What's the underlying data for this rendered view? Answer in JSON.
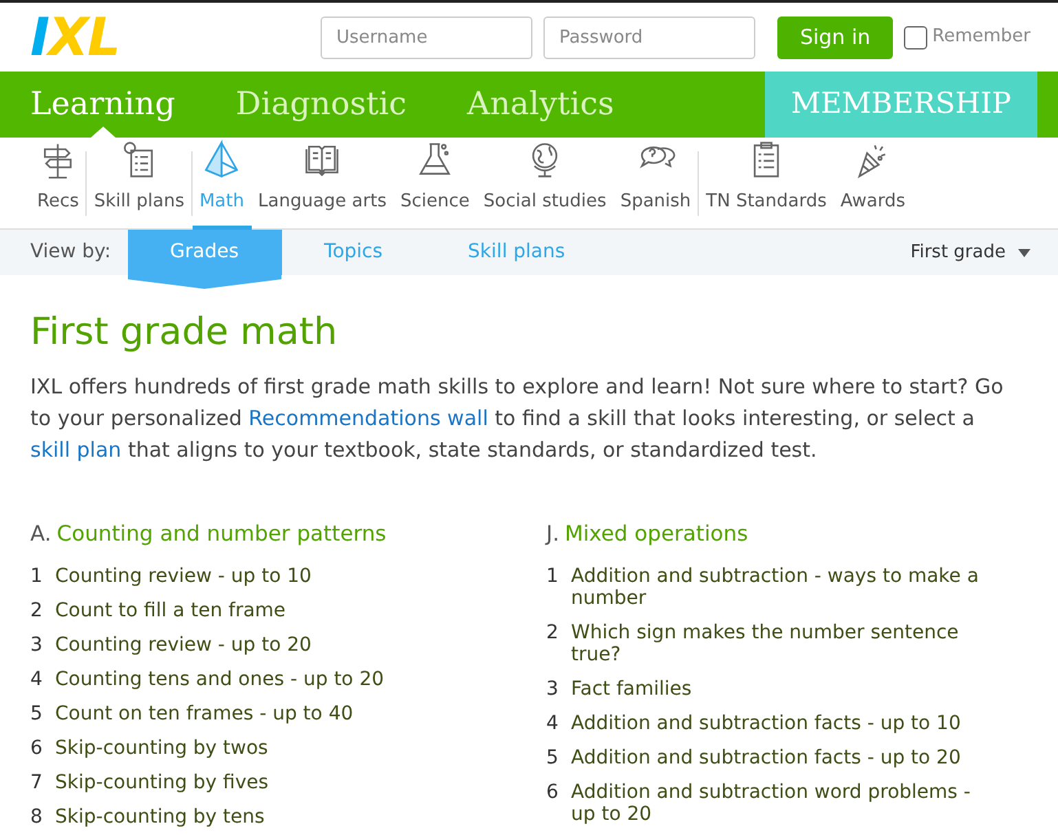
{
  "header": {
    "logo": "IXL",
    "username": {
      "placeholder": "Username"
    },
    "password": {
      "placeholder": "Password"
    },
    "sign_in": "Sign in",
    "remember": {
      "label": "Remember",
      "checked": false
    }
  },
  "main_nav": {
    "items": [
      {
        "label": "Learning",
        "selected": true
      },
      {
        "label": "Diagnostic",
        "selected": false
      },
      {
        "label": "Analytics",
        "selected": false
      }
    ],
    "membership": "MEMBERSHIP"
  },
  "subjects": [
    {
      "kind": "signpost",
      "label": "Recs",
      "selected": false,
      "divider_after": true
    },
    {
      "kind": "checklist",
      "label": "Skill plans",
      "selected": false,
      "divider_after": true
    },
    {
      "kind": "pyramid",
      "label": "Math",
      "selected": true,
      "divider_after": false
    },
    {
      "kind": "book",
      "label": "Language arts",
      "selected": false,
      "divider_after": false
    },
    {
      "kind": "flask",
      "label": "Science",
      "selected": false,
      "divider_after": false
    },
    {
      "kind": "globe",
      "label": "Social studies",
      "selected": false,
      "divider_after": false
    },
    {
      "kind": "speech",
      "label": "Spanish",
      "selected": false,
      "divider_after": true
    },
    {
      "kind": "clipboard",
      "label": "TN Standards",
      "selected": false,
      "divider_after": false
    },
    {
      "kind": "party",
      "label": "Awards",
      "selected": false,
      "divider_after": false
    }
  ],
  "view_by": {
    "label": "View by:",
    "tabs": [
      {
        "label": "Grades",
        "selected": true
      },
      {
        "label": "Topics",
        "selected": false
      },
      {
        "label": "Skill plans",
        "selected": false
      }
    ],
    "grade": "First grade"
  },
  "title": "First grade math",
  "intro": [
    {
      "kind": "text",
      "text": "IXL offers hundreds of first grade math skills to explore and learn! Not sure where to start? Go to your personalized"
    },
    {
      "kind": "link",
      "text": "Recommendations wall"
    },
    {
      "kind": "text",
      "text": "to find a skill that looks interesting, or select a"
    },
    {
      "kind": "link",
      "text": "skill plan"
    },
    {
      "kind": "text",
      "text": "that aligns to your textbook, state standards, or standardized test."
    }
  ],
  "sections": [
    {
      "letter": "A.",
      "title": "Counting and number patterns",
      "skills": [
        {
          "number": "1",
          "name": "Counting review - up to 10"
        },
        {
          "number": "2",
          "name": "Count to fill a ten frame"
        },
        {
          "number": "3",
          "name": "Counting review - up to 20"
        },
        {
          "number": "4",
          "name": "Counting tens and ones - up to 20"
        },
        {
          "number": "5",
          "name": "Count on ten frames - up to 40"
        },
        {
          "number": "6",
          "name": "Skip-counting by twos"
        },
        {
          "number": "7",
          "name": "Skip-counting by fives"
        },
        {
          "number": "8",
          "name": "Skip-counting by tens"
        }
      ]
    },
    {
      "letter": "J.",
      "title": "Mixed operations",
      "skills": [
        {
          "number": "1",
          "name": "Addition and subtraction - ways to make a number"
        },
        {
          "number": "2",
          "name": "Which sign makes the number sentence true?"
        },
        {
          "number": "3",
          "name": "Fact families"
        },
        {
          "number": "4",
          "name": "Addition and subtraction facts - up to 10"
        },
        {
          "number": "5",
          "name": "Addition and subtraction facts - up to 20"
        },
        {
          "number": "6",
          "name": "Addition and subtraction word problems - up to 20"
        }
      ]
    }
  ]
}
